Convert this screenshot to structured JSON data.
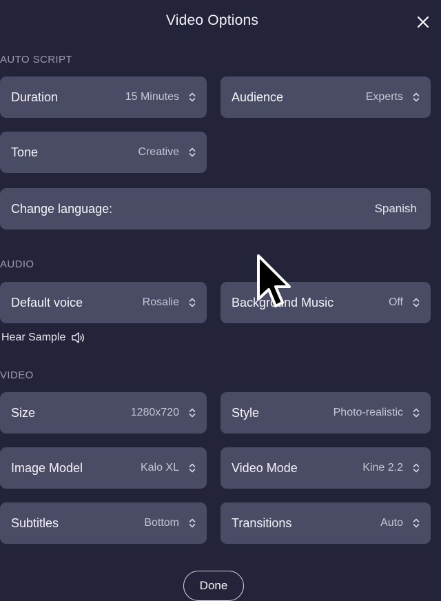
{
  "dialog": {
    "title": "Video Options"
  },
  "sections": {
    "auto_script": "AUTO SCRIPT",
    "audio": "AUDIO",
    "video": "VIDEO"
  },
  "auto_script": {
    "duration": {
      "label": "Duration",
      "value": "15 Minutes"
    },
    "audience": {
      "label": "Audience",
      "value": "Experts"
    },
    "tone": {
      "label": "Tone",
      "value": "Creative"
    },
    "language": {
      "label": "Change language:",
      "value": "Spanish"
    }
  },
  "audio": {
    "default_voice": {
      "label": "Default voice",
      "value": "Rosalie"
    },
    "background_music": {
      "label": "Background Music",
      "value": "Off"
    },
    "hear_sample": "Hear Sample"
  },
  "video": {
    "size": {
      "label": "Size",
      "value": "1280x720"
    },
    "style": {
      "label": "Style",
      "value": "Photo-realistic"
    },
    "image_model": {
      "label": "Image Model",
      "value": "Kalo XL"
    },
    "video_mode": {
      "label": "Video Mode",
      "value": "Kine 2.2"
    },
    "subtitles": {
      "label": "Subtitles",
      "value": "Bottom"
    },
    "transitions": {
      "label": "Transitions",
      "value": "Auto"
    }
  },
  "footer": {
    "done_label": "Done"
  },
  "icons": {
    "close": "close-icon",
    "chevron": "chevron-up-down-icon",
    "speaker": "speaker-icon",
    "cursor": "mouse-pointer-icon"
  },
  "colors": {
    "background": "#23243a",
    "field": "#4a4c66",
    "section_label": "#9a9cb0"
  }
}
